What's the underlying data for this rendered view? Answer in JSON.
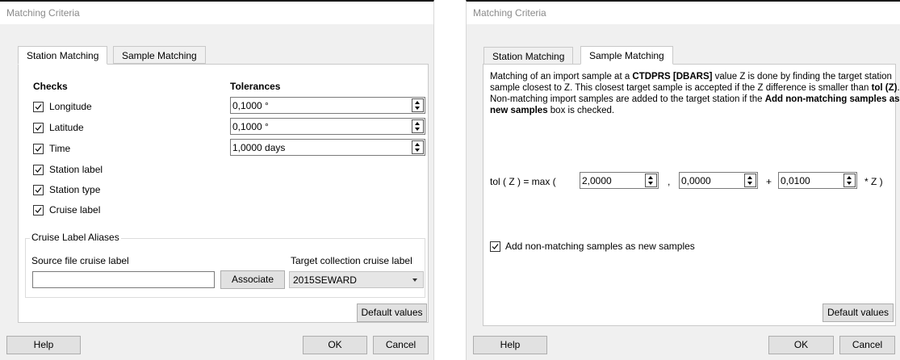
{
  "left_dialog": {
    "title": "Matching Criteria",
    "tabs": [
      {
        "label": "Station Matching",
        "active": true
      },
      {
        "label": "Sample Matching",
        "active": false
      }
    ],
    "checks_header": "Checks",
    "tolerances_header": "Tolerances",
    "checks": [
      {
        "label": "Longitude",
        "checked": true
      },
      {
        "label": "Latitude",
        "checked": true
      },
      {
        "label": "Time",
        "checked": true
      },
      {
        "label": "Station label",
        "checked": true
      },
      {
        "label": "Station type",
        "checked": true
      },
      {
        "label": "Cruise label",
        "checked": true
      }
    ],
    "tolerances": [
      "0,1000 °",
      "0,1000 °",
      "1,0000 days"
    ],
    "aliases": {
      "group_title": "Cruise Label Aliases",
      "source_label": "Source file cruise label",
      "target_label": "Target collection cruise label",
      "source_value": "",
      "associate_button": "Associate",
      "target_selected": "2015SEWARD"
    },
    "default_values_button": "Default values",
    "help_button": "Help",
    "ok_button": "OK",
    "cancel_button": "Cancel"
  },
  "right_dialog": {
    "title": "Matching Criteria",
    "tabs": [
      {
        "label": "Station Matching",
        "active": false
      },
      {
        "label": "Sample Matching",
        "active": true
      }
    ],
    "description": {
      "p1": "Matching of an import sample at a ",
      "b1": "CTDPRS [DBARS]",
      "p2": " value Z is done by finding the target station sample closest to Z. This closest target sample is accepted if the Z difference is smaller than ",
      "b2": "tol (Z)",
      "p3": ". Non-matching import samples are added to the target station if the ",
      "b3": "Add non-matching samples as new samples",
      "p4": " box is checked."
    },
    "formula": {
      "prefix": "tol ( Z ) = max (",
      "value1": "2,0000",
      "sep1": ",",
      "value2": "0,0000",
      "sep2": "+",
      "value3": "0,0100",
      "suffix": "* Z )"
    },
    "add_nonmatching": {
      "label": "Add non-matching samples as new samples",
      "checked": true
    },
    "default_values_button": "Default values",
    "help_button": "Help",
    "ok_button": "OK",
    "cancel_button": "Cancel"
  }
}
